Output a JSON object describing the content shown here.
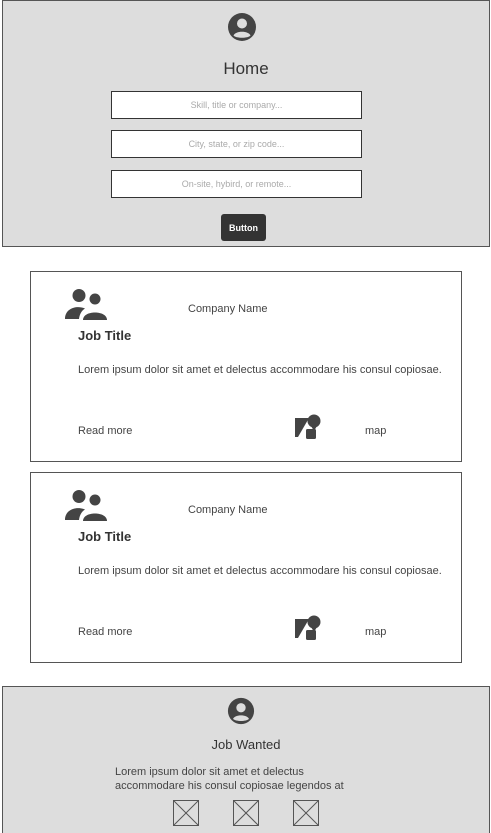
{
  "header": {
    "title": "Home",
    "search_fields": [
      {
        "placeholder": "Skill, title or company..."
      },
      {
        "placeholder": "City, state, or zip code..."
      },
      {
        "placeholder": "On-site, hybird, or remote..."
      }
    ],
    "button_label": "Button",
    "avatar_icon": "user-circle-icon"
  },
  "cards": [
    {
      "company": "Company Name",
      "title": "Job Title",
      "description": "Lorem ipsum dolor sit amet et delectus accommodare his consul copiosae.",
      "read_more": "Read more",
      "map_label": "map",
      "icon": "people-icon",
      "map_icon": "map-icon"
    },
    {
      "company": "Company Name",
      "title": "Job Title",
      "description": "Lorem ipsum dolor sit amet et delectus accommodare his consul copiosae.",
      "read_more": "Read more",
      "map_label": "map",
      "icon": "people-icon",
      "map_icon": "map-icon"
    }
  ],
  "footer": {
    "title": "Job Wanted",
    "description": "Lorem ipsum dolor sit amet et delectus accommodare his consul copiosae legendos at",
    "avatar_icon": "user-circle-icon",
    "image_placeholders": [
      "image-placeholder-icon",
      "image-placeholder-icon",
      "image-placeholder-icon"
    ]
  },
  "colors": {
    "panel_bg": "#dddddd",
    "dark": "#333333",
    "border": "#555555"
  }
}
